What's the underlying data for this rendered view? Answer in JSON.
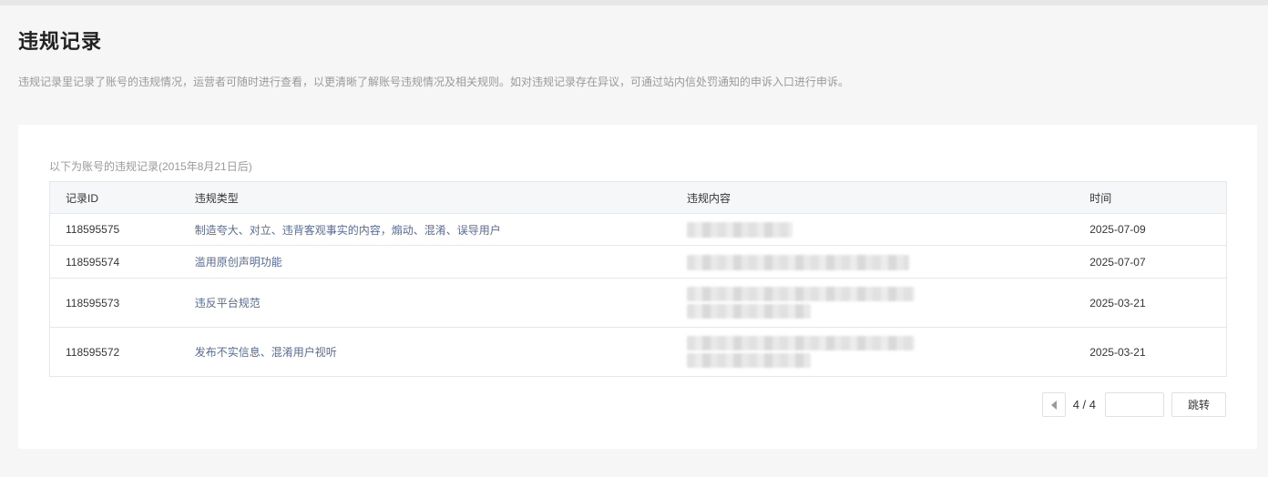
{
  "page": {
    "title": "违规记录",
    "description": "违规记录里记录了账号的违规情况，运营者可随时进行查看，以更清晰了解账号违规情况及相关规则。如对违规记录存在异议，可通过站内信处罚通知的申诉入口进行申诉。"
  },
  "records": {
    "note": "以下为账号的违规记录(2015年8月21日后)",
    "columns": {
      "id": "记录ID",
      "type": "违规类型",
      "content": "违规内容",
      "time": "时间"
    },
    "rows": [
      {
        "id": "118595575",
        "type": "制造夸大、对立、违背客观事实的内容，煽动、混淆、误导用户",
        "time": "2025-07-09"
      },
      {
        "id": "118595574",
        "type": "滥用原创声明功能",
        "time": "2025-07-07"
      },
      {
        "id": "118595573",
        "type": "违反平台规范",
        "time": "2025-03-21"
      },
      {
        "id": "118595572",
        "type": "发布不实信息、混淆用户视听",
        "time": "2025-03-21"
      }
    ]
  },
  "pagination": {
    "page_text": "4 / 4",
    "jump_label": "跳转",
    "prev_icon": "caret-left-icon"
  }
}
